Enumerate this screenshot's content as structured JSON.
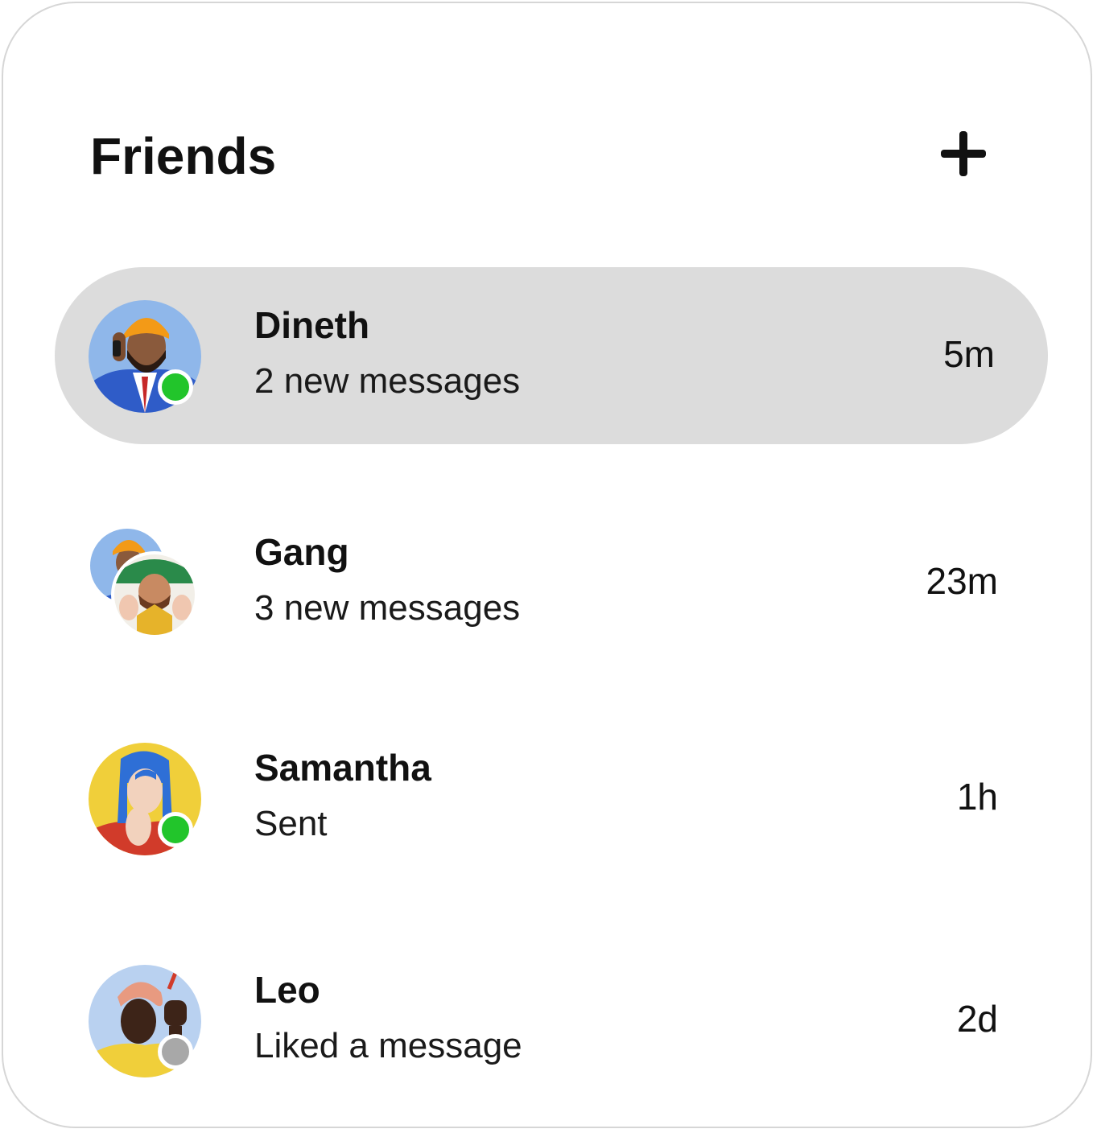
{
  "header": {
    "title": "Friends",
    "add_icon": "plus-icon"
  },
  "colors": {
    "selected_row": "#dcdcdc",
    "online": "#22c52b",
    "offline": "#a8a8a8",
    "border": "#d6d6d6"
  },
  "friends": [
    {
      "name": "Dineth",
      "subtitle": "2 new messages",
      "time": "5m",
      "status": "online",
      "avatar": "avatar-man-turban",
      "selected": true
    },
    {
      "name": "Gang",
      "subtitle": "3 new messages",
      "time": "23m",
      "status": "none",
      "avatar": "group-avatar",
      "selected": false
    },
    {
      "name": "Samantha",
      "subtitle": "Sent",
      "time": "1h",
      "status": "online",
      "avatar": "avatar-woman-blue-hair",
      "selected": false
    },
    {
      "name": "Leo",
      "subtitle": "Liked a message",
      "time": "2d",
      "status": "offline",
      "avatar": "avatar-man-pink-turban",
      "selected": false
    }
  ]
}
